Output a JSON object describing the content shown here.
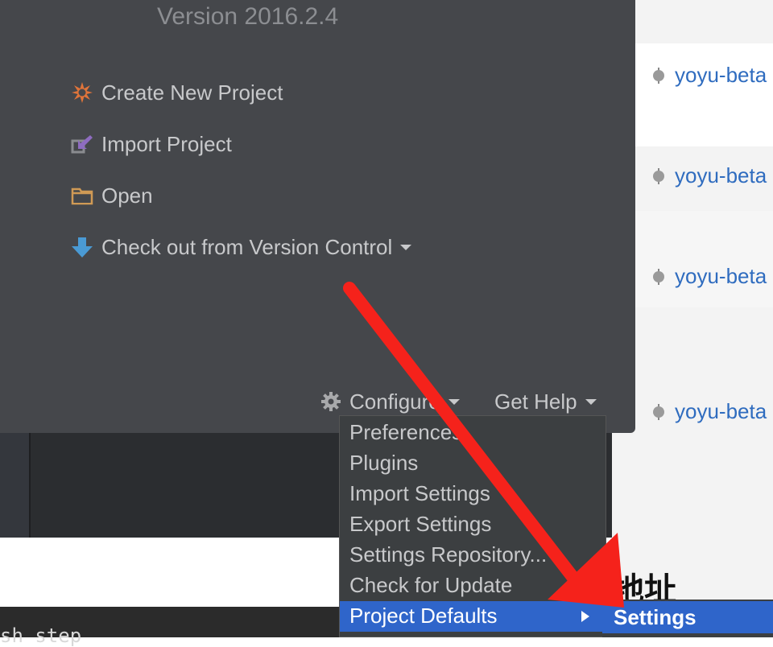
{
  "app": {
    "version": "Version 2016.2.4"
  },
  "actions": [
    {
      "label": "Create New Project",
      "icon": "starburst-icon"
    },
    {
      "label": "Import Project",
      "icon": "import-icon"
    },
    {
      "label": "Open",
      "icon": "folder-icon"
    },
    {
      "label": "Check out from Version Control",
      "icon": "down-arrow-icon"
    }
  ],
  "footer": {
    "configure_label": "Configure",
    "get_help_label": "Get Help"
  },
  "configure_menu": {
    "items": [
      "Preferences",
      "Plugins",
      "Import Settings",
      "Export Settings",
      "Settings Repository...",
      "Check for Update",
      "Project Defaults"
    ],
    "selected": "Project Defaults"
  },
  "submenu": {
    "selected_label": "Settings"
  },
  "background": {
    "branches": [
      "yoyu-beta",
      "yoyu-beta",
      "yoyu-beta",
      "yoyu-beta"
    ],
    "heading_fragment": "地址",
    "terminal_text": "sh step"
  },
  "colors": {
    "accent_selection": "#2f65ca",
    "annotation_arrow": "#f5221b",
    "branch_link": "#2f6cbf"
  }
}
